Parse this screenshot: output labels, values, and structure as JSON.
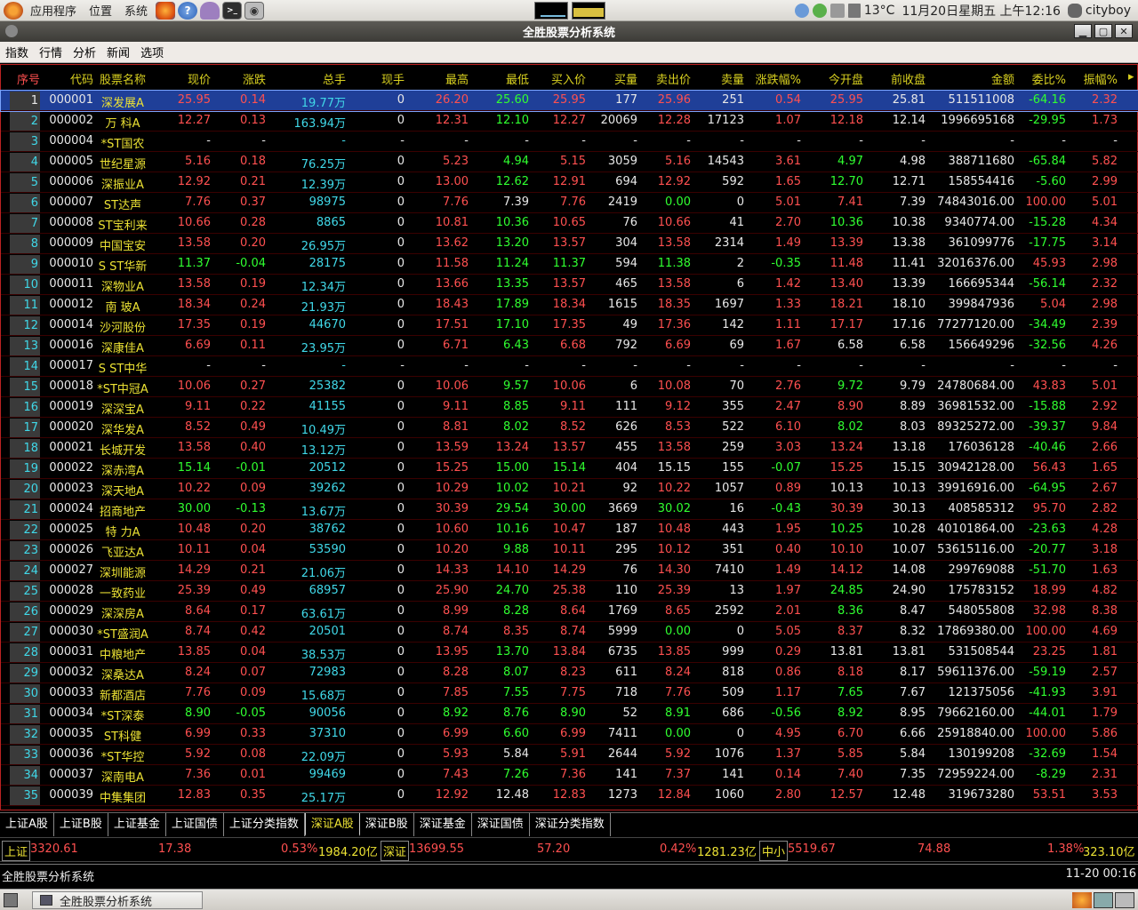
{
  "system": {
    "menus": [
      "应用程序",
      "位置",
      "系统"
    ],
    "weather": "13°C",
    "datetime": "11月20日星期五 上午12:16",
    "user": "cityboy"
  },
  "window": {
    "title": "全胜股票分析系统"
  },
  "menubar": [
    "指数",
    "行情",
    "分析",
    "新闻",
    "选项"
  ],
  "columns": [
    "序号",
    "代码",
    "股票名称",
    "现价",
    "涨跌",
    "总手",
    "现手",
    "最高",
    "最低",
    "买入价",
    "买量",
    "卖出价",
    "卖量",
    "涨跌幅%",
    "今开盘",
    "前收盘",
    "金额",
    "委比%",
    "振幅%"
  ],
  "rows": [
    [
      "1",
      "000001",
      "深发展A",
      "25.95",
      "0.14",
      "19.77万",
      "0",
      "26.20",
      "25.60",
      "25.95",
      "177",
      "25.96",
      "251",
      "0.54",
      "25.95",
      "25.81",
      "511511008",
      "-64.16",
      "2.32"
    ],
    [
      "2",
      "000002",
      "万 科A",
      "12.27",
      "0.13",
      "163.94万",
      "0",
      "12.31",
      "12.10",
      "12.27",
      "20069",
      "12.28",
      "17123",
      "1.07",
      "12.18",
      "12.14",
      "1996695168",
      "-29.95",
      "1.73"
    ],
    [
      "3",
      "000004",
      "*ST国农",
      "-",
      "-",
      "-",
      "-",
      "-",
      "-",
      "-",
      "-",
      "-",
      "-",
      "-",
      "-",
      "-",
      "-",
      "-",
      "-"
    ],
    [
      "4",
      "000005",
      "世纪星源",
      "5.16",
      "0.18",
      "76.25万",
      "0",
      "5.23",
      "4.94",
      "5.15",
      "3059",
      "5.16",
      "14543",
      "3.61",
      "4.97",
      "4.98",
      "388711680",
      "-65.84",
      "5.82"
    ],
    [
      "5",
      "000006",
      "深振业A",
      "12.92",
      "0.21",
      "12.39万",
      "0",
      "13.00",
      "12.62",
      "12.91",
      "694",
      "12.92",
      "592",
      "1.65",
      "12.70",
      "12.71",
      "158554416",
      "-5.60",
      "2.99"
    ],
    [
      "6",
      "000007",
      "ST达声",
      "7.76",
      "0.37",
      "98975",
      "0",
      "7.76",
      "7.39",
      "7.76",
      "2419",
      "0.00",
      "0",
      "5.01",
      "7.41",
      "7.39",
      "74843016.00",
      "100.00",
      "5.01"
    ],
    [
      "7",
      "000008",
      "ST宝利来",
      "10.66",
      "0.28",
      "8865",
      "0",
      "10.81",
      "10.36",
      "10.65",
      "76",
      "10.66",
      "41",
      "2.70",
      "10.36",
      "10.38",
      "9340774.00",
      "-15.28",
      "4.34"
    ],
    [
      "8",
      "000009",
      "中国宝安",
      "13.58",
      "0.20",
      "26.95万",
      "0",
      "13.62",
      "13.20",
      "13.57",
      "304",
      "13.58",
      "2314",
      "1.49",
      "13.39",
      "13.38",
      "361099776",
      "-17.75",
      "3.14"
    ],
    [
      "9",
      "000010",
      "S ST华新",
      "11.37",
      "-0.04",
      "28175",
      "0",
      "11.58",
      "11.24",
      "11.37",
      "594",
      "11.38",
      "2",
      "-0.35",
      "11.48",
      "11.41",
      "32016376.00",
      "45.93",
      "2.98"
    ],
    [
      "10",
      "000011",
      "深物业A",
      "13.58",
      "0.19",
      "12.34万",
      "0",
      "13.66",
      "13.35",
      "13.57",
      "465",
      "13.58",
      "6",
      "1.42",
      "13.40",
      "13.39",
      "166695344",
      "-56.14",
      "2.32"
    ],
    [
      "11",
      "000012",
      "南 玻A",
      "18.34",
      "0.24",
      "21.93万",
      "0",
      "18.43",
      "17.89",
      "18.34",
      "1615",
      "18.35",
      "1697",
      "1.33",
      "18.21",
      "18.10",
      "399847936",
      "5.04",
      "2.98"
    ],
    [
      "12",
      "000014",
      "沙河股份",
      "17.35",
      "0.19",
      "44670",
      "0",
      "17.51",
      "17.10",
      "17.35",
      "49",
      "17.36",
      "142",
      "1.11",
      "17.17",
      "17.16",
      "77277120.00",
      "-34.49",
      "2.39"
    ],
    [
      "13",
      "000016",
      "深康佳A",
      "6.69",
      "0.11",
      "23.95万",
      "0",
      "6.71",
      "6.43",
      "6.68",
      "792",
      "6.69",
      "69",
      "1.67",
      "6.58",
      "6.58",
      "156649296",
      "-32.56",
      "4.26"
    ],
    [
      "14",
      "000017",
      "S ST中华",
      "-",
      "-",
      "-",
      "-",
      "-",
      "-",
      "-",
      "-",
      "-",
      "-",
      "-",
      "-",
      "-",
      "-",
      "-",
      "-"
    ],
    [
      "15",
      "000018",
      "*ST中冠A",
      "10.06",
      "0.27",
      "25382",
      "0",
      "10.06",
      "9.57",
      "10.06",
      "6",
      "10.08",
      "70",
      "2.76",
      "9.72",
      "9.79",
      "24780684.00",
      "43.83",
      "5.01"
    ],
    [
      "16",
      "000019",
      "深深宝A",
      "9.11",
      "0.22",
      "41155",
      "0",
      "9.11",
      "8.85",
      "9.11",
      "111",
      "9.12",
      "355",
      "2.47",
      "8.90",
      "8.89",
      "36981532.00",
      "-15.88",
      "2.92"
    ],
    [
      "17",
      "000020",
      "深华发A",
      "8.52",
      "0.49",
      "10.49万",
      "0",
      "8.81",
      "8.02",
      "8.52",
      "626",
      "8.53",
      "522",
      "6.10",
      "8.02",
      "8.03",
      "89325272.00",
      "-39.37",
      "9.84"
    ],
    [
      "18",
      "000021",
      "长城开发",
      "13.58",
      "0.40",
      "13.12万",
      "0",
      "13.59",
      "13.24",
      "13.57",
      "455",
      "13.58",
      "259",
      "3.03",
      "13.24",
      "13.18",
      "176036128",
      "-40.46",
      "2.66"
    ],
    [
      "19",
      "000022",
      "深赤湾A",
      "15.14",
      "-0.01",
      "20512",
      "0",
      "15.25",
      "15.00",
      "15.14",
      "404",
      "15.15",
      "155",
      "-0.07",
      "15.25",
      "15.15",
      "30942128.00",
      "56.43",
      "1.65"
    ],
    [
      "20",
      "000023",
      "深天地A",
      "10.22",
      "0.09",
      "39262",
      "0",
      "10.29",
      "10.02",
      "10.21",
      "92",
      "10.22",
      "1057",
      "0.89",
      "10.13",
      "10.13",
      "39916916.00",
      "-64.95",
      "2.67"
    ],
    [
      "21",
      "000024",
      "招商地产",
      "30.00",
      "-0.13",
      "13.67万",
      "0",
      "30.39",
      "29.54",
      "30.00",
      "3669",
      "30.02",
      "16",
      "-0.43",
      "30.39",
      "30.13",
      "408585312",
      "95.70",
      "2.82"
    ],
    [
      "22",
      "000025",
      "特 力A",
      "10.48",
      "0.20",
      "38762",
      "0",
      "10.60",
      "10.16",
      "10.47",
      "187",
      "10.48",
      "443",
      "1.95",
      "10.25",
      "10.28",
      "40101864.00",
      "-23.63",
      "4.28"
    ],
    [
      "23",
      "000026",
      "飞亚达A",
      "10.11",
      "0.04",
      "53590",
      "0",
      "10.20",
      "9.88",
      "10.11",
      "295",
      "10.12",
      "351",
      "0.40",
      "10.10",
      "10.07",
      "53615116.00",
      "-20.77",
      "3.18"
    ],
    [
      "24",
      "000027",
      "深圳能源",
      "14.29",
      "0.21",
      "21.06万",
      "0",
      "14.33",
      "14.10",
      "14.29",
      "76",
      "14.30",
      "7410",
      "1.49",
      "14.12",
      "14.08",
      "299769088",
      "-51.70",
      "1.63"
    ],
    [
      "25",
      "000028",
      "一致药业",
      "25.39",
      "0.49",
      "68957",
      "0",
      "25.90",
      "24.70",
      "25.38",
      "110",
      "25.39",
      "13",
      "1.97",
      "24.85",
      "24.90",
      "175783152",
      "18.99",
      "4.82"
    ],
    [
      "26",
      "000029",
      "深深房A",
      "8.64",
      "0.17",
      "63.61万",
      "0",
      "8.99",
      "8.28",
      "8.64",
      "1769",
      "8.65",
      "2592",
      "2.01",
      "8.36",
      "8.47",
      "548055808",
      "32.98",
      "8.38"
    ],
    [
      "27",
      "000030",
      "*ST盛润A",
      "8.74",
      "0.42",
      "20501",
      "0",
      "8.74",
      "8.35",
      "8.74",
      "5999",
      "0.00",
      "0",
      "5.05",
      "8.37",
      "8.32",
      "17869380.00",
      "100.00",
      "4.69"
    ],
    [
      "28",
      "000031",
      "中粮地产",
      "13.85",
      "0.04",
      "38.53万",
      "0",
      "13.95",
      "13.70",
      "13.84",
      "6735",
      "13.85",
      "999",
      "0.29",
      "13.81",
      "13.81",
      "531508544",
      "23.25",
      "1.81"
    ],
    [
      "29",
      "000032",
      "深桑达A",
      "8.24",
      "0.07",
      "72983",
      "0",
      "8.28",
      "8.07",
      "8.23",
      "611",
      "8.24",
      "818",
      "0.86",
      "8.18",
      "8.17",
      "59611376.00",
      "-59.19",
      "2.57"
    ],
    [
      "30",
      "000033",
      "新都酒店",
      "7.76",
      "0.09",
      "15.68万",
      "0",
      "7.85",
      "7.55",
      "7.75",
      "718",
      "7.76",
      "509",
      "1.17",
      "7.65",
      "7.67",
      "121375056",
      "-41.93",
      "3.91"
    ],
    [
      "31",
      "000034",
      "*ST深泰",
      "8.90",
      "-0.05",
      "90056",
      "0",
      "8.92",
      "8.76",
      "8.90",
      "52",
      "8.91",
      "686",
      "-0.56",
      "8.92",
      "8.95",
      "79662160.00",
      "-44.01",
      "1.79"
    ],
    [
      "32",
      "000035",
      "ST科健",
      "6.99",
      "0.33",
      "37310",
      "0",
      "6.99",
      "6.60",
      "6.99",
      "7411",
      "0.00",
      "0",
      "4.95",
      "6.70",
      "6.66",
      "25918840.00",
      "100.00",
      "5.86"
    ],
    [
      "33",
      "000036",
      "*ST华控",
      "5.92",
      "0.08",
      "22.09万",
      "0",
      "5.93",
      "5.84",
      "5.91",
      "2644",
      "5.92",
      "1076",
      "1.37",
      "5.85",
      "5.84",
      "130199208",
      "-32.69",
      "1.54"
    ],
    [
      "34",
      "000037",
      "深南电A",
      "7.36",
      "0.01",
      "99469",
      "0",
      "7.43",
      "7.26",
      "7.36",
      "141",
      "7.37",
      "141",
      "0.14",
      "7.40",
      "7.35",
      "72959224.00",
      "-8.29",
      "2.31"
    ],
    [
      "35",
      "000039",
      "中集集团",
      "12.83",
      "0.35",
      "25.17万",
      "0",
      "12.92",
      "12.48",
      "12.83",
      "1273",
      "12.84",
      "1060",
      "2.80",
      "12.57",
      "12.48",
      "319673280",
      "53.51",
      "3.53"
    ]
  ],
  "tabs": [
    "上证A股",
    "上证B股",
    "上证基金",
    "上证国债",
    "上证分类指数",
    "深证A股",
    "深证B股",
    "深证基金",
    "深证国债",
    "深证分类指数"
  ],
  "active_tab": "深证A股",
  "index_bar": {
    "sh": {
      "label": "上证",
      "value": "3320.61",
      "change": "17.38",
      "pct": "0.53%",
      "amount": "1984.20亿"
    },
    "sz": {
      "label": "深证",
      "value": "13699.55",
      "change": "57.20",
      "pct": "0.42%",
      "amount": "1281.23亿"
    },
    "zx": {
      "label": "中小",
      "value": "5519.67",
      "change": "74.88",
      "pct": "1.38%",
      "amount": "323.10亿"
    }
  },
  "status": {
    "left": "全胜股票分析系统",
    "right": "11-20 00:16"
  },
  "taskbar": {
    "item": "全胜股票分析系统"
  },
  "colors": {
    "up": "#ff5050",
    "down": "#30ff30",
    "name": "#ece234",
    "volume": "#40d8e8",
    "selected": "#1f3f98"
  }
}
